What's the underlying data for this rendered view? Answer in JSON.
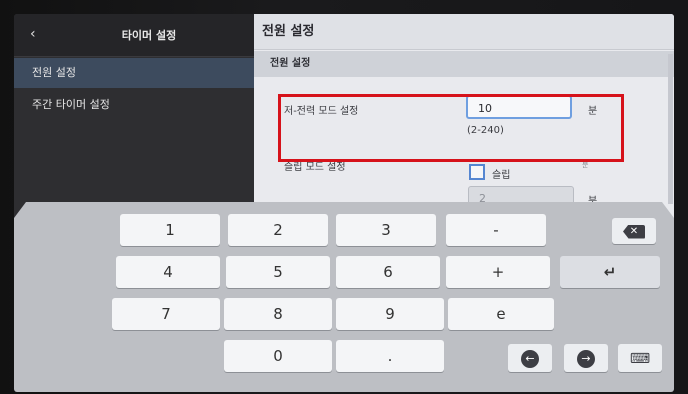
{
  "sidebar": {
    "title": "타이머 설정",
    "back_icon": "chevron-left-icon",
    "items": [
      {
        "label": "전원 설정",
        "active": true
      },
      {
        "label": "주간 타이머 설정",
        "active": false
      }
    ]
  },
  "main": {
    "title": "전원 설정",
    "section": "전원 설정",
    "low_power": {
      "label": "저-전력 모드 설정",
      "value": "10",
      "unit": "분",
      "range": "(2-240)"
    },
    "sleep": {
      "label": "슬립 모드 설정",
      "checkbox_label": "슬립",
      "value": "2",
      "unit": "분",
      "small_unit": "분"
    }
  },
  "keyboard": {
    "rows": [
      [
        "1",
        "2",
        "3",
        "-"
      ],
      [
        "4",
        "5",
        "6",
        "+"
      ],
      [
        "7",
        "8",
        "9",
        "e"
      ],
      [
        "0",
        "."
      ]
    ],
    "icons": {
      "backspace": "backspace-icon",
      "enter": "enter-icon",
      "left": "arrow-left-icon",
      "right": "arrow-right-icon",
      "keyboard": "keyboard-icon"
    }
  },
  "colors": {
    "highlight": "#d6121a",
    "accent": "#6f9fe0"
  }
}
